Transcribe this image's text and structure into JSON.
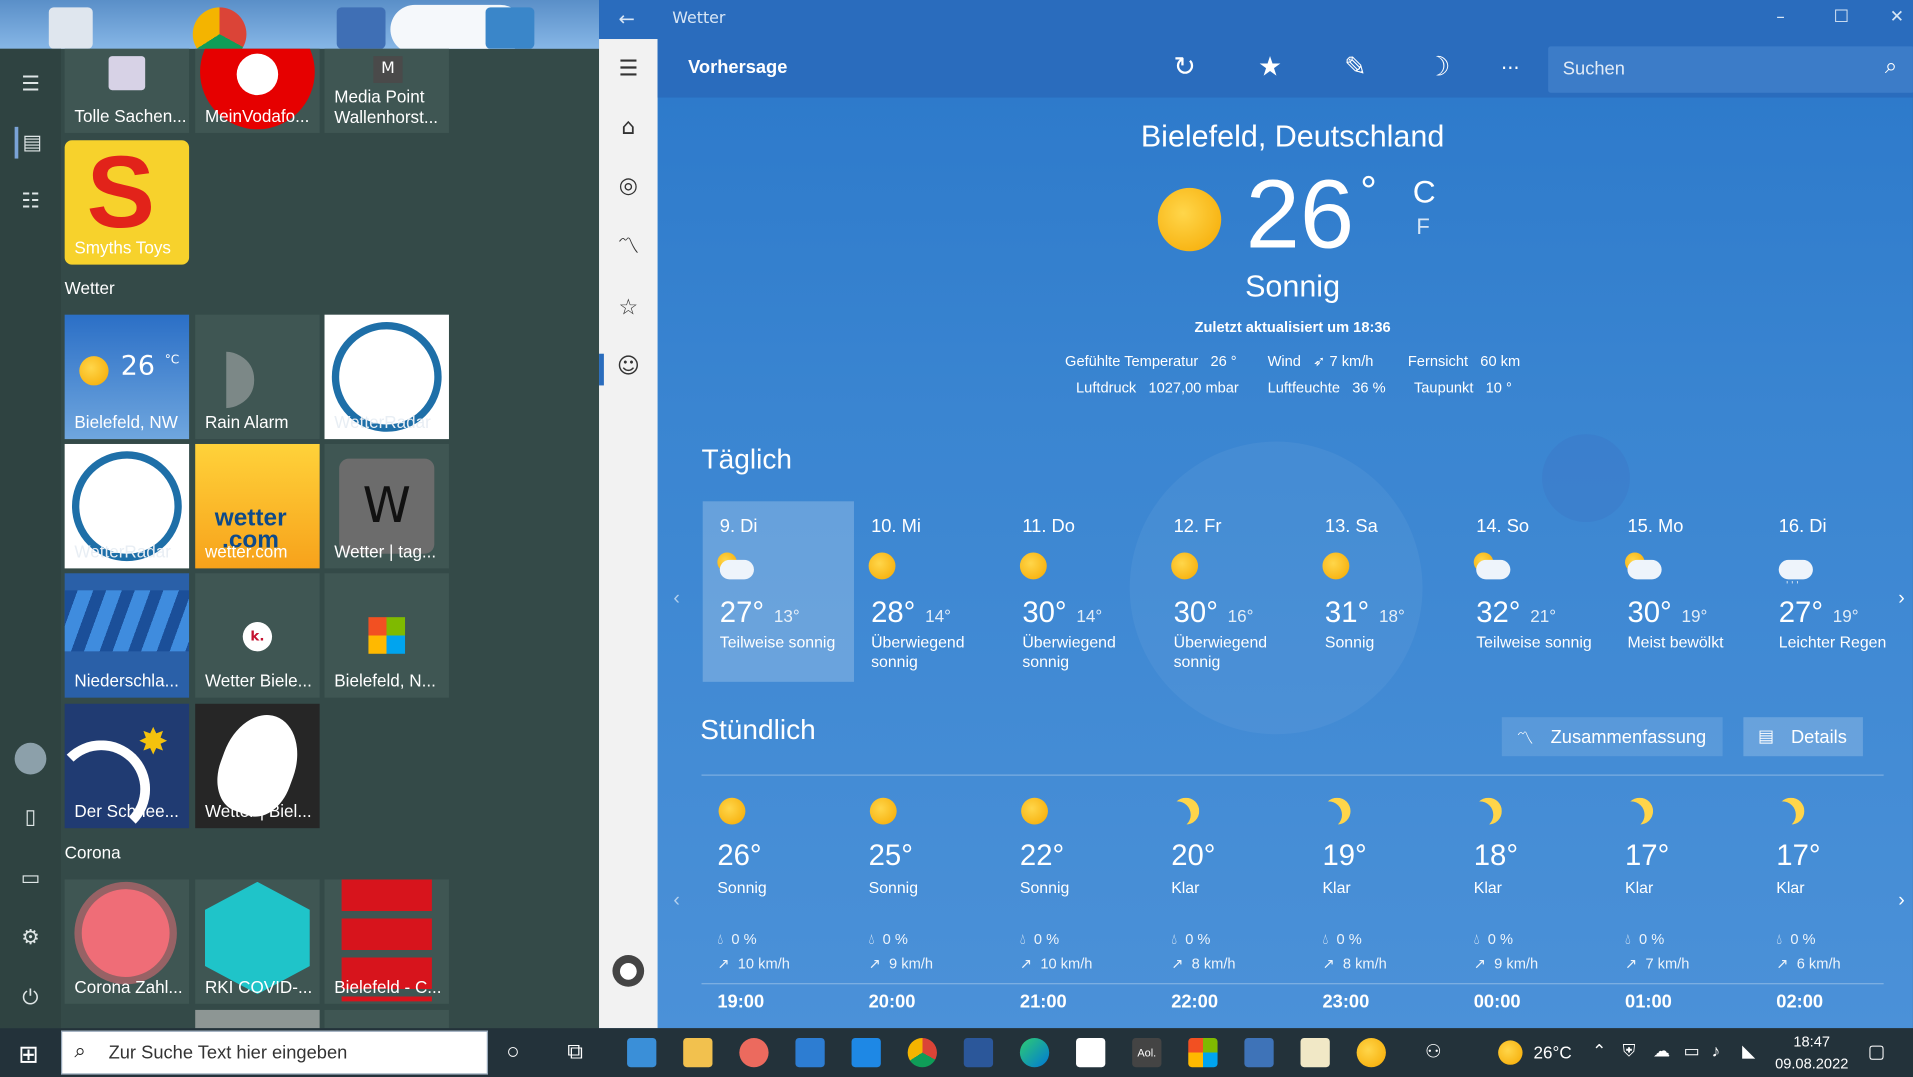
{
  "start": {
    "tiles_top": [
      {
        "label": "Tolle Sachen..."
      },
      {
        "label": "MeinVodafo..."
      },
      {
        "label": "Media Point Wallenhorst...",
        "letter": "M"
      }
    ],
    "smyths": "Smyths Toys",
    "group_wetter": "Wetter",
    "weather_tile": {
      "temp": "26",
      "unit": "°C",
      "city": "Bielefeld, NW"
    },
    "tiles": [
      {
        "label": "Rain Alarm"
      },
      {
        "label": "WetterRadar"
      },
      {
        "label": "WetterRadar"
      },
      {
        "label": "wetter.com",
        "logo1": "wetter",
        "logo2": ".com"
      },
      {
        "label": "Wetter | tag...",
        "letter": "W"
      },
      {
        "label": "Niederschla..."
      },
      {
        "label": "Wetter Biele...",
        "letter": "k."
      },
      {
        "label": "Bielefeld, N..."
      },
      {
        "label": "Der Schnee..."
      },
      {
        "label": "Wetter | Biel..."
      }
    ],
    "group_corona": "Corona",
    "corona": [
      {
        "label": "Corona Zahl..."
      },
      {
        "label": "RKI COVID-..."
      },
      {
        "label": "Bielefeld - C..."
      }
    ]
  },
  "app": {
    "title": "Wetter",
    "section": "Vorhersage",
    "search_placeholder": "Suchen",
    "more": "···",
    "location": "Bielefeld, Deutschland",
    "temp": "26",
    "deg": "°",
    "unit_c": "C",
    "unit_f": "F",
    "condition": "Sonnig",
    "updated": "Zuletzt aktualisiert um 18:36",
    "details": [
      [
        {
          "k": "Gefühlte Temperatur",
          "v": "26 °"
        },
        {
          "k": "Wind",
          "v": "7 km/h"
        },
        {
          "k": "Fernsicht",
          "v": "60 km"
        }
      ],
      [
        {
          "k": "Luftdruck",
          "v": "1027,00 mbar"
        },
        {
          "k": "Luftfeuchte",
          "v": "36 %"
        },
        {
          "k": "Taupunkt",
          "v": "10 °"
        }
      ]
    ],
    "daily_title": "Täglich",
    "days": [
      {
        "d": "9. Di",
        "hi": "27°",
        "lo": "13°",
        "c": "Teilweise sonnig",
        "icon": "partly"
      },
      {
        "d": "10. Mi",
        "hi": "28°",
        "lo": "14°",
        "c": "Überwiegend sonnig",
        "icon": "sun"
      },
      {
        "d": "11. Do",
        "hi": "30°",
        "lo": "14°",
        "c": "Überwiegend sonnig",
        "icon": "sun"
      },
      {
        "d": "12. Fr",
        "hi": "30°",
        "lo": "16°",
        "c": "Überwiegend sonnig",
        "icon": "sun"
      },
      {
        "d": "13. Sa",
        "hi": "31°",
        "lo": "18°",
        "c": "Sonnig",
        "icon": "sun"
      },
      {
        "d": "14. So",
        "hi": "32°",
        "lo": "21°",
        "c": "Teilweise sonnig",
        "icon": "partly"
      },
      {
        "d": "15. Mo",
        "hi": "30°",
        "lo": "19°",
        "c": "Meist bewölkt",
        "icon": "partly"
      },
      {
        "d": "16. Di",
        "hi": "27°",
        "lo": "19°",
        "c": "Leichter Regen",
        "icon": "rain"
      }
    ],
    "hourly_title": "Stündlich",
    "summary_btn": "Zusammenfassung",
    "details_btn": "Details",
    "hours": [
      {
        "t": "26°",
        "c": "Sonnig",
        "p": "0 %",
        "w": "10 km/h",
        "h": "19:00",
        "icon": "sun"
      },
      {
        "t": "25°",
        "c": "Sonnig",
        "p": "0 %",
        "w": "9 km/h",
        "h": "20:00",
        "icon": "sun"
      },
      {
        "t": "22°",
        "c": "Sonnig",
        "p": "0 %",
        "w": "10 km/h",
        "h": "21:00",
        "icon": "sun"
      },
      {
        "t": "20°",
        "c": "Klar",
        "p": "0 %",
        "w": "8 km/h",
        "h": "22:00",
        "icon": "moon"
      },
      {
        "t": "19°",
        "c": "Klar",
        "p": "0 %",
        "w": "8 km/h",
        "h": "23:00",
        "icon": "moon"
      },
      {
        "t": "18°",
        "c": "Klar",
        "p": "0 %",
        "w": "9 km/h",
        "h": "00:00",
        "icon": "moon"
      },
      {
        "t": "17°",
        "c": "Klar",
        "p": "0 %",
        "w": "7 km/h",
        "h": "01:00",
        "icon": "moon"
      },
      {
        "t": "17°",
        "c": "Klar",
        "p": "0 %",
        "w": "6 km/h",
        "h": "02:00",
        "icon": "moon"
      }
    ]
  },
  "taskbar": {
    "search_placeholder": "Zur Suche Text hier eingeben",
    "weather_temp": "26°C",
    "time": "18:47",
    "date": "09.08.2022",
    "aol": "Aol."
  }
}
